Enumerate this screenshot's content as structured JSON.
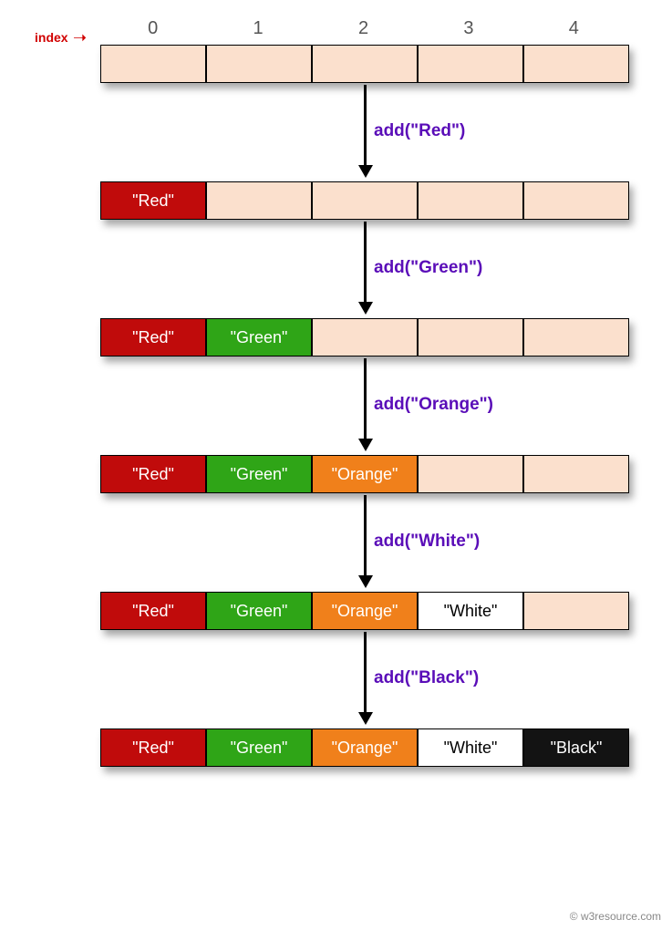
{
  "index_label": "index",
  "indices": [
    "0",
    "1",
    "2",
    "3",
    "4"
  ],
  "steps": [
    {
      "op": "add(\"Red\")"
    },
    {
      "op": "add(\"Green\")"
    },
    {
      "op": "add(\"Orange\")"
    },
    {
      "op": "add(\"White\")"
    },
    {
      "op": "add(\"Black\")"
    }
  ],
  "rows": [
    {
      "cells": [
        {
          "text": "",
          "cls": "empty"
        },
        {
          "text": "",
          "cls": "empty"
        },
        {
          "text": "",
          "cls": "empty"
        },
        {
          "text": "",
          "cls": "empty"
        },
        {
          "text": "",
          "cls": "empty"
        }
      ]
    },
    {
      "cells": [
        {
          "text": "\"Red\"",
          "cls": "red"
        },
        {
          "text": "",
          "cls": "empty"
        },
        {
          "text": "",
          "cls": "empty"
        },
        {
          "text": "",
          "cls": "empty"
        },
        {
          "text": "",
          "cls": "empty"
        }
      ]
    },
    {
      "cells": [
        {
          "text": "\"Red\"",
          "cls": "red"
        },
        {
          "text": "\"Green\"",
          "cls": "green"
        },
        {
          "text": "",
          "cls": "empty"
        },
        {
          "text": "",
          "cls": "empty"
        },
        {
          "text": "",
          "cls": "empty"
        }
      ]
    },
    {
      "cells": [
        {
          "text": "\"Red\"",
          "cls": "red"
        },
        {
          "text": "\"Green\"",
          "cls": "green"
        },
        {
          "text": "\"Orange\"",
          "cls": "orange"
        },
        {
          "text": "",
          "cls": "empty"
        },
        {
          "text": "",
          "cls": "empty"
        }
      ]
    },
    {
      "cells": [
        {
          "text": "\"Red\"",
          "cls": "red"
        },
        {
          "text": "\"Green\"",
          "cls": "green"
        },
        {
          "text": "\"Orange\"",
          "cls": "orange"
        },
        {
          "text": "\"White\"",
          "cls": "white"
        },
        {
          "text": "",
          "cls": "empty"
        }
      ]
    },
    {
      "cells": [
        {
          "text": "\"Red\"",
          "cls": "red"
        },
        {
          "text": "\"Green\"",
          "cls": "green"
        },
        {
          "text": "\"Orange\"",
          "cls": "orange"
        },
        {
          "text": "\"White\"",
          "cls": "white"
        },
        {
          "text": "\"Black\"",
          "cls": "black"
        }
      ]
    }
  ],
  "watermark": "© w3resource.com"
}
